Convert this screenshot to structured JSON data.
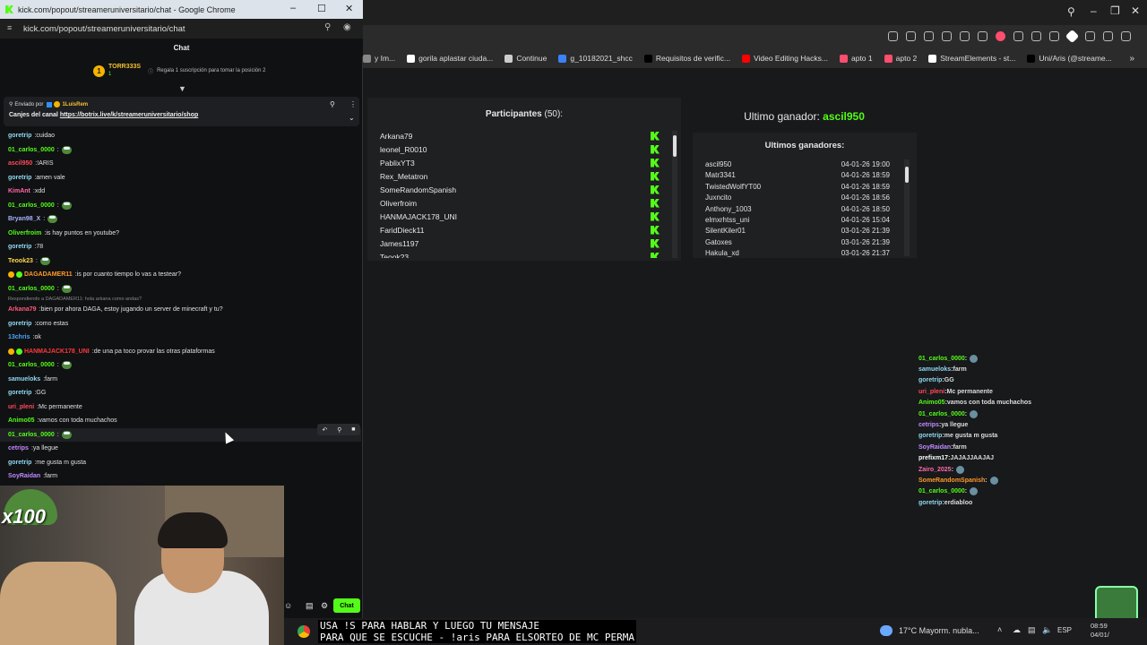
{
  "popout": {
    "title": "kick.com/popout/streameruniversitario/chat - Google Chrome",
    "url": "kick.com/popout/streameruniversitario/chat",
    "chat_header": "Chat",
    "top_gifter": {
      "name": "TORR333S",
      "count": "1",
      "info": "Regala 1 suscripción para tomar la posición 2"
    },
    "pinned": {
      "sent_by_label": "Enviado por",
      "sent_by_user": "1LuisRem",
      "text": "Canjes del canal ",
      "link": "https://botrix.live/k/streameruniversitario/shop"
    },
    "reply_context": "Respondiendo a DAGADAMER11: hola arkana como andas?",
    "messages": [
      {
        "user": "goretrip",
        "color": "#8fd8f0",
        "text": "cuidao"
      },
      {
        "user": "01_carlos_0000",
        "color": "#53fc18",
        "text": "",
        "emote": true
      },
      {
        "user": "ascil950",
        "color": "#ff4a5a",
        "text": "!ARIS"
      },
      {
        "user": "goretrip",
        "color": "#8fd8f0",
        "text": "amen vale"
      },
      {
        "user": "KimAnt",
        "color": "#ff6aa8",
        "text": "xdd"
      },
      {
        "user": "01_carlos_0000",
        "color": "#53fc18",
        "text": "",
        "emote": true
      },
      {
        "user": "Bryan98_X",
        "color": "#a8b4ff",
        "text": "",
        "emote": true
      },
      {
        "user": "Oliverfroim",
        "color": "#53fc18",
        "text": "is hay puntos en youtube?"
      },
      {
        "user": "goretrip",
        "color": "#8fd8f0",
        "text": "78"
      },
      {
        "user": "Teook23",
        "color": "#ffd84a",
        "text": "",
        "emote": true
      },
      {
        "user": "DAGADAMER11",
        "color": "#ff9a2a",
        "text": "is por cuanto tiempo lo vas a testear?",
        "badges": true
      },
      {
        "user": "01_carlos_0000",
        "color": "#53fc18",
        "text": "",
        "emote": true
      },
      {
        "user": "Arkana79",
        "color": "#ff5a7a",
        "text": "bien por ahora DAGA, estoy jugando un server de minecraft y tu?",
        "reply": true
      },
      {
        "user": "goretrip",
        "color": "#8fd8f0",
        "text": "como estas"
      },
      {
        "user": "13chris",
        "color": "#4aa8ff",
        "text": "ok"
      },
      {
        "user": "HANMAJACK178_UNI",
        "color": "#ff3a3a",
        "text": "de una pa toco provar las otras plataformas",
        "badges": true
      },
      {
        "user": "01_carlos_0000",
        "color": "#53fc18",
        "text": "",
        "emote": true
      },
      {
        "user": "samueloks",
        "color": "#8fd8f0",
        "text": "farm"
      },
      {
        "user": "goretrip",
        "color": "#8fd8f0",
        "text": "GG"
      },
      {
        "user": "uri_pleni",
        "color": "#ff4a5a",
        "text": "Mc permanente"
      },
      {
        "user": "Animo05",
        "color": "#53fc18",
        "text": "vamos con toda muchachos"
      },
      {
        "user": "01_carlos_0000",
        "color": "#53fc18",
        "text": "",
        "emote": true,
        "hover": true
      },
      {
        "user": "cetrips",
        "color": "#c08aff",
        "text": "ya llegue"
      },
      {
        "user": "goretrip",
        "color": "#8fd8f0",
        "text": "me gusta m gusta"
      },
      {
        "user": "SoyRaidan",
        "color": "#c08aff",
        "text": "farm"
      }
    ],
    "chat_button": "Chat",
    "cam_overlay": "x100"
  },
  "bg_browser": {
    "bookmarks": [
      {
        "label": "y Im...",
        "color": "#888"
      },
      {
        "label": "gorila aplastar ciuda...",
        "color": "#ffffff"
      },
      {
        "label": "Continue",
        "color": "#cccccc"
      },
      {
        "label": "g_10182021_shcc",
        "color": "#3b82f6"
      },
      {
        "label": "Requisitos de verific...",
        "color": "#000000"
      },
      {
        "label": "Video Editing Hacks...",
        "color": "#ff0000"
      },
      {
        "label": "apto 1",
        "color": "#ff4d6d"
      },
      {
        "label": "apto 2",
        "color": "#ff4d6d"
      },
      {
        "label": "StreamElements - st...",
        "color": "#ffffff"
      },
      {
        "label": "Uni/Aris (@streame...",
        "color": "#000000"
      }
    ]
  },
  "giveaway": {
    "participants_label": "Participantes",
    "participants_count": "(50):",
    "participants": [
      "Arkana79",
      "leonel_R0010",
      "PablixYT3",
      "Rex_Metatron",
      "SomeRandomSpanish",
      "Oliverfroim",
      "HANMAJACK178_UNI",
      "FaridDieck11",
      "James1197",
      "Teook23"
    ],
    "last_winner_label": "Ultimo ganador:",
    "last_winner": "ascil950",
    "last_winners_title": "Ultimos ganadores:",
    "winners": [
      {
        "name": "ascil950",
        "date": "04-01-26 19:00"
      },
      {
        "name": "Matr3341",
        "date": "04-01-26 18:59"
      },
      {
        "name": "TwistedWolfYT00",
        "date": "04-01-26 18:59"
      },
      {
        "name": "Juxncito",
        "date": "04-01-26 18:56"
      },
      {
        "name": "Anthony_1003",
        "date": "04-01-26 18:50"
      },
      {
        "name": "elmxrhtss_uni",
        "date": "04-01-26 15:04"
      },
      {
        "name": "SilentKiler01",
        "date": "03-01-26 21:39"
      },
      {
        "name": "Gatoxes",
        "date": "03-01-26 21:39"
      },
      {
        "name": "Hakula_xd",
        "date": "03-01-26 21:37"
      }
    ]
  },
  "right_chat": [
    {
      "user": "01_carlos_0000",
      "color": "#53fc18",
      "text": "",
      "emote": true
    },
    {
      "user": "samueloks",
      "color": "#8fd8f0",
      "text": "farm"
    },
    {
      "user": "goretrip",
      "color": "#8fd8f0",
      "text": "GG"
    },
    {
      "user": "uri_pleni",
      "color": "#ff4a5a",
      "text": "Mc permanente"
    },
    {
      "user": "Animo05",
      "color": "#53fc18",
      "text": "vamos con toda muchachos"
    },
    {
      "user": "01_carlos_0000",
      "color": "#53fc18",
      "text": "",
      "emote": true
    },
    {
      "user": "cetrips",
      "color": "#c08aff",
      "text": "ya llegue"
    },
    {
      "user": "goretrip",
      "color": "#8fd8f0",
      "text": "me gusta m gusta"
    },
    {
      "user": "SoyRaidan",
      "color": "#c08aff",
      "text": "farm"
    },
    {
      "user": "prefixm17",
      "color": "#ffffff",
      "text": "JAJAJJAAJAJ"
    },
    {
      "user": "Zairo_2025",
      "color": "#ff6aa8",
      "text": "",
      "emote": true
    },
    {
      "user": "SomeRandomSpanish",
      "color": "#ff9a2a",
      "text": "",
      "emote": true
    },
    {
      "user": "01_carlos_0000",
      "color": "#53fc18",
      "text": "",
      "emote": true
    },
    {
      "user": "goretrip",
      "color": "#8fd8f0",
      "text": "erdiabloo"
    }
  ],
  "taskbar": {
    "overlay_line1": "USA !S PARA HABLAR Y LUEGO TU MENSAJE",
    "overlay_line2": "PARA QUE SE ESCUCHE - !aris PARA ELSORTEO DE MC PERMA",
    "weather": "17°C  Mayorm. nubla...",
    "lang": "ESP",
    "time": "08:59",
    "date": "04/01/"
  },
  "colors": {
    "kick_green": "#53fc18",
    "link_blue": "#4a9eff"
  }
}
